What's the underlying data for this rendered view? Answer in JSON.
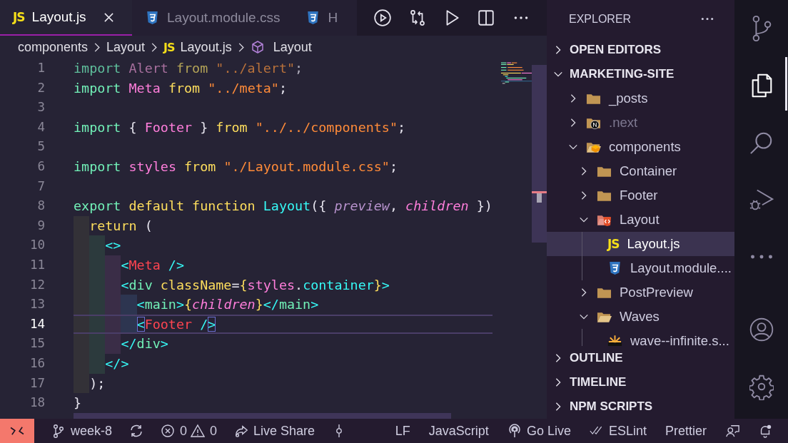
{
  "tabs": [
    {
      "label": "Layout.js",
      "kind": "js",
      "icon_text": "JS",
      "selected": true,
      "close": true
    },
    {
      "label": "Layout.module.css",
      "kind": "css",
      "selected": false,
      "close": false
    },
    {
      "label": "H",
      "kind": "css",
      "selected": false,
      "close": false
    }
  ],
  "toolbar": [
    {
      "kind": "run-circle"
    },
    {
      "kind": "compare"
    },
    {
      "kind": "play"
    },
    {
      "kind": "split"
    },
    {
      "kind": "more"
    }
  ],
  "breadcrumbs": [
    {
      "label": "components",
      "kind": "folder"
    },
    {
      "label": "Layout",
      "kind": "folder"
    },
    {
      "label": "Layout.js",
      "kind": "js",
      "icon_text": "JS"
    },
    {
      "label": "Layout",
      "kind": "symbol"
    }
  ],
  "editor": {
    "lines": [
      {
        "number": "1",
        "current": false,
        "tokens": [
          {
            "text": "import ",
            "kind": "dim-kw"
          },
          {
            "text": "Alert ",
            "kind": "dim-id"
          },
          {
            "text": "from ",
            "kind": "dim-from"
          },
          {
            "text": "\"../alert\"",
            "kind": "dim-str"
          },
          {
            "text": ";",
            "kind": "dim-punct"
          }
        ]
      },
      {
        "number": "2",
        "current": false,
        "tokens": [
          {
            "text": "import ",
            "kind": "kw"
          },
          {
            "text": "Meta ",
            "kind": "id"
          },
          {
            "text": "from ",
            "kind": "from"
          },
          {
            "text": "\"../meta\"",
            "kind": "str"
          },
          {
            "text": ";",
            "kind": "punct"
          }
        ]
      },
      {
        "number": "3",
        "current": false
      },
      {
        "number": "4",
        "current": false,
        "tokens": [
          {
            "text": "import ",
            "kind": "kw"
          },
          {
            "text": "{ ",
            "kind": "punct"
          },
          {
            "text": "Footer ",
            "kind": "id"
          },
          {
            "text": "} ",
            "kind": "punct"
          },
          {
            "text": "from ",
            "kind": "from"
          },
          {
            "text": "\"../../components\"",
            "kind": "str"
          },
          {
            "text": ";",
            "kind": "punct"
          }
        ]
      },
      {
        "number": "5",
        "current": false
      },
      {
        "number": "6",
        "current": false,
        "tokens": [
          {
            "text": "import ",
            "kind": "kw"
          },
          {
            "text": "styles ",
            "kind": "id"
          },
          {
            "text": "from ",
            "kind": "from"
          },
          {
            "text": "\"./Layout.module.css\"",
            "kind": "str"
          },
          {
            "text": ";",
            "kind": "punct"
          }
        ]
      },
      {
        "number": "7",
        "current": false
      },
      {
        "number": "8",
        "current": false,
        "tokens": [
          {
            "text": "export ",
            "kind": "kw"
          },
          {
            "text": "default ",
            "kind": "from"
          },
          {
            "text": "function ",
            "kind": "from"
          },
          {
            "text": "Layout",
            "kind": "fn"
          },
          {
            "text": "({ ",
            "kind": "punct"
          },
          {
            "text": "preview",
            "kind": "param-dim"
          },
          {
            "text": ", ",
            "kind": "punct"
          },
          {
            "text": "children",
            "kind": "param"
          },
          {
            "text": " })",
            "kind": "punct"
          }
        ]
      },
      {
        "number": "9",
        "current": false,
        "tokens": [
          {
            "text": "  return ",
            "kind": "from"
          },
          {
            "text": "(",
            "kind": "punct"
          }
        ]
      },
      {
        "number": "10",
        "current": false,
        "tokens": [
          {
            "text": "    <>",
            "kind": "jsx"
          }
        ]
      },
      {
        "number": "11",
        "current": false,
        "tokens": [
          {
            "text": "      <",
            "kind": "jsx"
          },
          {
            "text": "Meta",
            "kind": "tag"
          },
          {
            "text": " />",
            "kind": "jsx"
          }
        ]
      },
      {
        "number": "12",
        "current": false,
        "tokens": [
          {
            "text": "      <",
            "kind": "jsx"
          },
          {
            "text": "div ",
            "kind": "kw"
          },
          {
            "text": "className",
            "kind": "from"
          },
          {
            "text": "=",
            "kind": "punct"
          },
          {
            "text": "{",
            "kind": "from"
          },
          {
            "text": "styles",
            "kind": "id"
          },
          {
            "text": ".",
            "kind": "punct"
          },
          {
            "text": "container",
            "kind": "fn"
          },
          {
            "text": "}",
            "kind": "from"
          },
          {
            "text": ">",
            "kind": "jsx"
          }
        ]
      },
      {
        "number": "13",
        "current": false,
        "tokens": [
          {
            "text": "        <",
            "kind": "jsx"
          },
          {
            "text": "main",
            "kind": "kw"
          },
          {
            "text": ">",
            "kind": "jsx"
          },
          {
            "text": "{",
            "kind": "from"
          },
          {
            "text": "children",
            "kind": "param"
          },
          {
            "text": "}",
            "kind": "from"
          },
          {
            "text": "</",
            "kind": "jsx"
          },
          {
            "text": "main",
            "kind": "kw"
          },
          {
            "text": ">",
            "kind": "jsx"
          }
        ]
      },
      {
        "number": "14",
        "current": true,
        "tokens": [
          {
            "text": "        <",
            "kind": "match"
          },
          {
            "text": "Footer",
            "kind": "tag"
          },
          {
            "text": " /",
            "kind": "jsx"
          },
          {
            "text": ">",
            "kind": "match"
          }
        ]
      },
      {
        "number": "15",
        "current": false,
        "tokens": [
          {
            "text": "      </",
            "kind": "jsx"
          },
          {
            "text": "div",
            "kind": "kw"
          },
          {
            "text": ">",
            "kind": "jsx"
          }
        ]
      },
      {
        "number": "16",
        "current": false,
        "tokens": [
          {
            "text": "    </>",
            "kind": "jsx"
          }
        ]
      },
      {
        "number": "17",
        "current": false,
        "tokens": [
          {
            "text": "  );",
            "kind": "punct"
          }
        ]
      },
      {
        "number": "18",
        "current": false,
        "tokens": [
          {
            "text": "}",
            "kind": "punct"
          }
        ]
      }
    ]
  },
  "sidebar": {
    "title": "EXPLORER",
    "sections": [
      {
        "label": "OPEN EDITORS",
        "expanded": false
      },
      {
        "label": "MARKETING-SITE",
        "expanded": true,
        "tree": [
          {
            "label": "_posts",
            "kind": "folder",
            "expanded": false,
            "selected": false,
            "ignored": false
          },
          {
            "label": ".next",
            "kind": "folder-next",
            "expanded": false,
            "selected": false,
            "ignored": true
          },
          {
            "label": "components",
            "kind": "folder-components",
            "expanded": true,
            "selected": false,
            "ignored": false,
            "children": [
              {
                "label": "Container",
                "kind": "folder",
                "expanded": false,
                "selected": false,
                "ignored": false
              },
              {
                "label": "Footer",
                "kind": "folder",
                "expanded": false,
                "selected": false,
                "ignored": false
              },
              {
                "label": "Layout",
                "kind": "folder-layout",
                "expanded": true,
                "selected": false,
                "ignored": false,
                "children": [
                  {
                    "label": "Layout.js",
                    "kind": "js",
                    "icon_text": "JS",
                    "selected": true,
                    "ignored": false
                  },
                  {
                    "label": "Layout.module....",
                    "kind": "css",
                    "selected": false,
                    "ignored": false
                  }
                ]
              },
              {
                "label": "PostPreview",
                "kind": "folder",
                "expanded": false,
                "selected": false,
                "ignored": false
              },
              {
                "label": "Waves",
                "kind": "folder",
                "expanded": true,
                "selected": false,
                "ignored": false,
                "children": [
                  {
                    "label": "wave--infinite.s...",
                    "kind": "svg",
                    "selected": false,
                    "ignored": false
                  }
                ]
              }
            ]
          }
        ]
      },
      {
        "label": "OUTLINE",
        "expanded": false
      },
      {
        "label": "TIMELINE",
        "expanded": false
      },
      {
        "label": "NPM SCRIPTS",
        "expanded": false
      }
    ]
  },
  "activity_bar": [
    {
      "kind": "source-control",
      "selected": false
    },
    {
      "kind": "explorer",
      "selected": true
    },
    {
      "kind": "search",
      "selected": false
    },
    {
      "kind": "run-debug",
      "selected": false
    },
    {
      "kind": "more",
      "selected": false
    },
    {
      "kind": "account",
      "selected": false
    },
    {
      "kind": "settings",
      "selected": false
    }
  ],
  "status_bar": {
    "left": [
      {
        "kind": "remote"
      },
      {
        "kind": "branch",
        "label": "week-8"
      },
      {
        "kind": "sync"
      },
      {
        "kind": "problems",
        "errors": "0",
        "warnings": "0"
      },
      {
        "kind": "liveshare",
        "label": "Live Share"
      },
      {
        "kind": "commit"
      }
    ],
    "right": [
      {
        "kind": "text",
        "label": "LF"
      },
      {
        "kind": "text",
        "label": "JavaScript"
      },
      {
        "kind": "golive",
        "label": "Go Live"
      },
      {
        "kind": "eslint",
        "label": "ESLint"
      },
      {
        "kind": "text",
        "label": "Prettier"
      },
      {
        "kind": "feedback"
      },
      {
        "kind": "bell"
      }
    ]
  }
}
